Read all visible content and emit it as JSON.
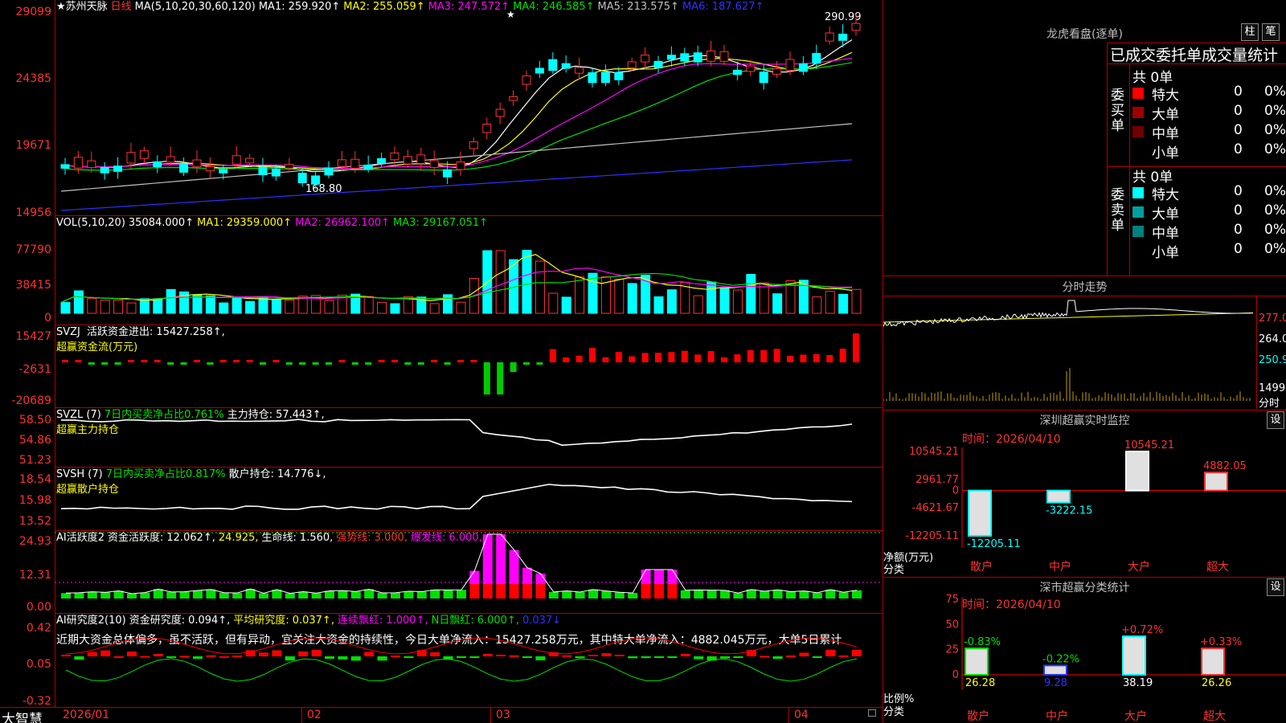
{
  "stock": {
    "name": "★苏州天脉",
    "period": "日线",
    "ma_label": "MA(5,10,20,30,60,120)",
    "ma": [
      {
        "k": "MA1:",
        "v": "259.920↑",
        "c": "#ffffff"
      },
      {
        "k": "MA2:",
        "v": "255.059↑",
        "c": "#ffff00"
      },
      {
        "k": "MA3:",
        "v": "247.572↑",
        "c": "#ff00ff"
      },
      {
        "k": "MA4:",
        "v": "246.585↑",
        "c": "#00e000"
      },
      {
        "k": "MA5:",
        "v": "213.575↑",
        "c": "#c0c0c0"
      },
      {
        "k": "MA6:",
        "v": "187.627↑",
        "c": "#3030ff"
      }
    ],
    "high_mark": "290.99",
    "low_mark": "168.80",
    "star": "★"
  },
  "price_axis": [
    "29099",
    "24385",
    "19671",
    "14956"
  ],
  "vol": {
    "header": "VOL(5,10,20)",
    "value": "35084.000↑",
    "ma": [
      {
        "k": "MA1:",
        "v": "29359.000↑",
        "c": "#ffff00"
      },
      {
        "k": "MA2:",
        "v": "26962.100↑",
        "c": "#ff00ff"
      },
      {
        "k": "MA3:",
        "v": "29167.051↑",
        "c": "#00e000"
      }
    ],
    "axis": [
      "77790",
      "38415",
      "0"
    ]
  },
  "svzj": {
    "header": "SVZJ",
    "label": "活跃资金进出:",
    "value": "15427.258↑,",
    "sub": "超赢资金流(万元)",
    "axis": [
      "15427",
      "-2631",
      "-20689"
    ]
  },
  "svzl": {
    "header": "SVZL (7)",
    "label1": "7日内买卖净占比0.761%",
    "label2": "主力持仓:",
    "value": "57.443↑,",
    "sub": "超赢主力持仓",
    "axis": [
      "58.50",
      "54.86",
      "51.23"
    ]
  },
  "svsh": {
    "header": "SVSH (7)",
    "label1": "7日内买卖净占比0.817%",
    "label2": "散户持仓:",
    "value": "14.776↓,",
    "sub": "超赢散户持仓",
    "axis": [
      "18.54",
      "15.98",
      "13.52"
    ]
  },
  "ai1": {
    "header": "AI活跃度2",
    "items": [
      {
        "t": "资金活跃度:",
        "c": "#ffffff"
      },
      {
        "t": "12.062↑,",
        "c": "#ffffff"
      },
      {
        "t": "24.925,",
        "c": "#ffff00"
      },
      {
        "t": "生命线:",
        "c": "#ffffff"
      },
      {
        "t": "1.560,",
        "c": "#ffffff"
      },
      {
        "t": "强势线:",
        "c": "#ff3232"
      },
      {
        "t": "3.000,",
        "c": "#ff3232"
      },
      {
        "t": "爆发线:",
        "c": "#ff00ff"
      },
      {
        "t": "6.000,",
        "c": "#ff00ff"
      }
    ],
    "axis": [
      "24.93",
      "12.31",
      "0.00"
    ]
  },
  "ai2": {
    "header": "AI研究度2(10)",
    "items": [
      {
        "t": "资金研究度:",
        "c": "#ffffff"
      },
      {
        "t": "0.094↑,",
        "c": "#ffffff"
      },
      {
        "t": "平均研究度:",
        "c": "#ffff00"
      },
      {
        "t": "0.037↑,",
        "c": "#ffff00"
      },
      {
        "t": "连续飘红:",
        "c": "#ff00ff"
      },
      {
        "t": "1.000↑,",
        "c": "#ff00ff"
      },
      {
        "t": "N日飘红:",
        "c": "#00e000"
      },
      {
        "t": "6.000↑,",
        "c": "#00e000"
      },
      {
        "t": "0.037↓",
        "c": "#3030ff"
      }
    ],
    "note": "近期大资金总体偏多，虽不活跃，但有异动，宜关注大资金的持续性，今日大单净流入：15427.258万元，其中特大单净流入：4882.045万元，大单5日累计",
    "axis": [
      "0.42",
      "0.05",
      "-0.32"
    ]
  },
  "bottom": {
    "brand": "大智慧",
    "dates": [
      "2026/01",
      "02",
      "03",
      "04"
    ]
  },
  "lhb": {
    "title": "龙虎看盘(逐单)",
    "btn1": "柱",
    "btn2": "笔",
    "tabs": "已成交委托单成交量统计",
    "buy": {
      "side": "委买单",
      "total": "共 0单",
      "rows": [
        {
          "n": "特大",
          "v": "0",
          "p": "0%",
          "c": "#ff0000"
        },
        {
          "n": "大单",
          "v": "0",
          "p": "0%",
          "c": "#a00000"
        },
        {
          "n": "中单",
          "v": "0",
          "p": "0%",
          "c": "#700000"
        },
        {
          "n": "小单",
          "v": "0",
          "p": "0%",
          "c": "#000000"
        }
      ]
    },
    "sell": {
      "side": "委卖单",
      "total": "共 0单",
      "rows": [
        {
          "n": "特大",
          "v": "0",
          "p": "0%",
          "c": "#00ffff"
        },
        {
          "n": "大单",
          "v": "0",
          "p": "0%",
          "c": "#00a0a0"
        },
        {
          "n": "中单",
          "v": "0",
          "p": "0%",
          "c": "#008080"
        },
        {
          "n": "小单",
          "v": "0",
          "p": "0%",
          "c": "#000000"
        }
      ]
    }
  },
  "fenshi": {
    "title": "分时走势",
    "axis": [
      "277.0",
      "264.0",
      "250.9",
      "1499"
    ],
    "label": "分时"
  },
  "szmon": {
    "title": "深圳超赢实时监控",
    "btn": "设",
    "time": "时间：2026/04/10",
    "axis": [
      "10545.21",
      "2961.77",
      "0",
      "-4621.67",
      "-12205.11"
    ],
    "ylabel": "净额(万元)",
    "xlabel": "分类",
    "cats": [
      "散户",
      "中户",
      "大户",
      "超大"
    ],
    "values": [
      "-12205.11",
      "-3222.15",
      "10545.21",
      "4882.05"
    ]
  },
  "szcls": {
    "title": "深市超赢分类统计",
    "btn": "设",
    "time": "时间：2026/04/10",
    "axis": [
      "75",
      "50",
      "25",
      "0"
    ],
    "ylabel": "比例%",
    "xlabel": "分类",
    "cats": [
      "散户",
      "中户",
      "大户",
      "超大"
    ],
    "top": [
      "-0.83%",
      "-0.22%",
      "+0.72%",
      "+0.33%"
    ],
    "values": [
      "26.28",
      "9.28",
      "38.19",
      "26.26"
    ]
  },
  "chart_data": [
    {
      "type": "bar",
      "title": "深圳超赢实时监控",
      "categories": [
        "散户",
        "中户",
        "大户",
        "超大"
      ],
      "values": [
        -12205.11,
        -3222.15,
        10545.21,
        4882.05
      ],
      "ylabel": "净额(万元)",
      "xlabel": "分类",
      "ylim": [
        -12205.11,
        10545.21
      ]
    },
    {
      "type": "bar",
      "title": "深市超赢分类统计",
      "categories": [
        "散户",
        "中户",
        "大户",
        "超大"
      ],
      "values": [
        26.28,
        9.28,
        38.19,
        26.26
      ],
      "change": [
        "-0.83%",
        "-0.22%",
        "+0.72%",
        "+0.33%"
      ],
      "ylabel": "比例%",
      "xlabel": "分类",
      "ylim": [
        0,
        75
      ]
    }
  ]
}
